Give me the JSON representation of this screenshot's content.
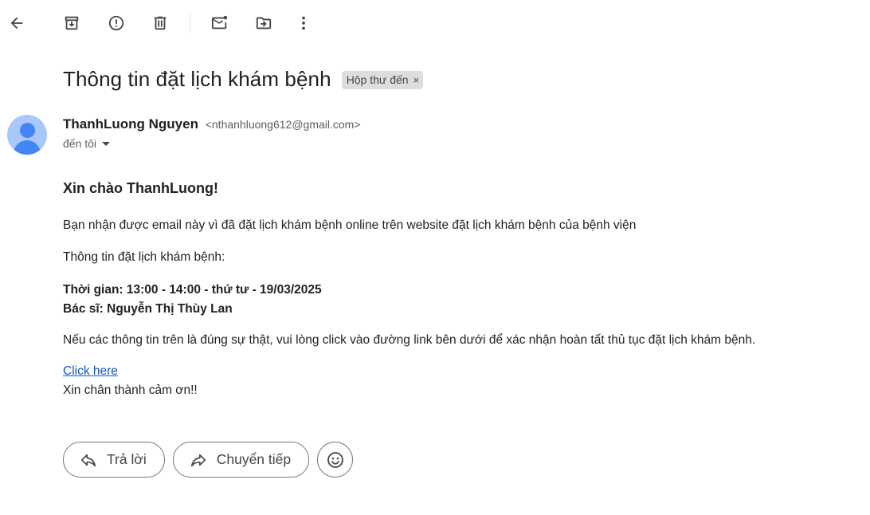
{
  "toolbar": {
    "icons": [
      "back-arrow-icon",
      "archive-icon",
      "report-spam-icon",
      "delete-icon",
      "mark-unread-icon",
      "move-to-icon",
      "more-vert-icon"
    ]
  },
  "subject": {
    "title": "Thông tin đặt lịch khám bệnh",
    "label": "Hộp thư đến",
    "label_remove": "×"
  },
  "sender": {
    "name": "ThanhLuong Nguyen",
    "email": "<nthanhluong612@gmail.com>",
    "to": "đến tôi"
  },
  "body": {
    "greeting": "Xin chào ThanhLuong!",
    "intro": "Bạn nhận được email này vì đã đặt lịch khám bệnh online trên website đặt lịch khám bệnh của bệnh viện",
    "info_heading": "Thông tin đặt lịch khám bệnh:",
    "time_line": "Thời gian: 13:00 - 14:00 - thứ tư - 19/03/2025",
    "doctor_line": "Bác sĩ: Nguyễn Thị Thùy Lan",
    "confirm": "Nếu các thông tin trên là đúng sự thật, vui lòng click vào đường link bên dưới để xác nhận hoàn tất thủ tục đặt lịch khám bệnh.",
    "link_text": "Click here",
    "thanks": "Xin chân thành cảm ơn!!"
  },
  "actions": {
    "reply": "Trả lời",
    "forward": "Chuyển tiếp"
  },
  "colors": {
    "link": "#1155cc",
    "avatar_bg": "#a8c7fa",
    "avatar_fg": "#4285f4",
    "chip_bg": "#dddddd"
  }
}
